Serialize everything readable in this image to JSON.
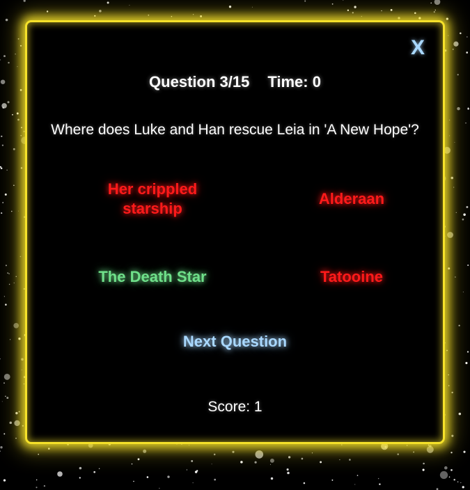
{
  "game": {
    "close_label": "X",
    "question_counter": "Question 3/15",
    "timer": "Time: 0",
    "question_text": "Where does Luke and Han rescue Leia in 'A New Hope'?",
    "answers": [
      {
        "label": "Her crippled starship",
        "state": "wrong"
      },
      {
        "label": "Alderaan",
        "state": "wrong"
      },
      {
        "label": "The Death Star",
        "state": "correct"
      },
      {
        "label": "Tatooine",
        "state": "wrong"
      }
    ],
    "next_label": "Next Question",
    "score": "Score: 1"
  },
  "colors": {
    "frame": "#f5e12a",
    "wrong": "#ff1a1a",
    "correct": "#6fe08a",
    "accent": "#a9d8ff",
    "background": "#000000"
  }
}
